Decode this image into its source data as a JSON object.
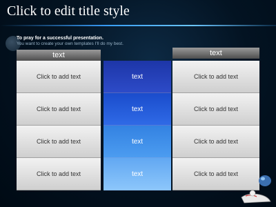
{
  "slide": {
    "title": "Click to edit title style",
    "subtitle": "To pray  for  a successful presentation.",
    "subtext": "You want to create your own templates I'll do my best."
  },
  "table": {
    "left_header": "text",
    "right_header": "text",
    "left_cells": [
      "Click to add text",
      "Click to add text",
      "Click to add text",
      "Click to add text"
    ],
    "middle_cells": [
      "text",
      "text",
      "text",
      "text"
    ],
    "right_cells": [
      "Click to add text",
      "Click to add text",
      "Click to add text",
      "Click to add text"
    ]
  },
  "colors": {
    "mid1": "#2540b8",
    "mid2": "#1e55d8",
    "mid3": "#3e8ee8",
    "mid4": "#6fb1f5"
  }
}
